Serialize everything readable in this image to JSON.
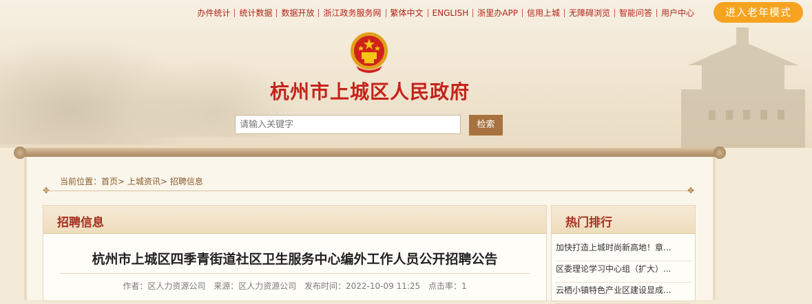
{
  "topnav": [
    "办件统计",
    "统计数据",
    "数据开放",
    "浙江政务服务网",
    "繁体中文",
    "ENGLISH",
    "浙里办APP",
    "信用上城",
    "无障碍浏览",
    "智能问答",
    "用户中心"
  ],
  "elder_mode": "进入老年模式",
  "site_title": "杭州市上城区人民政府",
  "search": {
    "placeholder": "请输入关键字",
    "button": "检索"
  },
  "breadcrumb": {
    "prefix": "当前位置：",
    "items": [
      "首页",
      "上城资讯",
      "招聘信息"
    ],
    "sep": ">"
  },
  "main_panel": {
    "heading": "招聘信息",
    "article_title": "杭州市上城区四季青街道社区卫生服务中心编外工作人员公开招聘公告",
    "meta": {
      "author": "作者：区人力资源公司",
      "source": "来源：区人力资源公司",
      "time": "发布时间：2022-10-09 11:25",
      "clicks": "点击率：1"
    }
  },
  "side_panel": {
    "heading": "热门排行",
    "items": [
      "加快打造上城时尚新高地！章...",
      "区委理论学习中心组（扩大）...",
      "云栖小镇特色产业区建设显成..."
    ]
  },
  "colors": {
    "brand_red": "#c5231a",
    "elder_orange": "#f6a31f",
    "search_btn": "#a7723f",
    "heading_red": "#a4301e"
  }
}
